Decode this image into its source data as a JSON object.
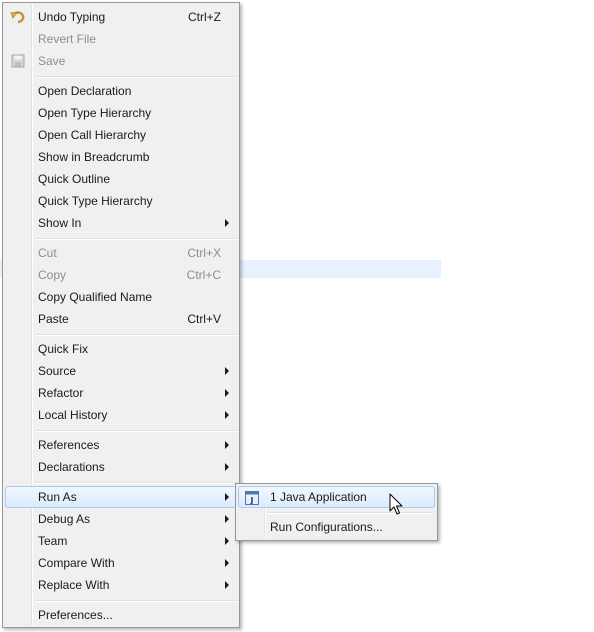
{
  "context_menu": {
    "items": [
      {
        "label": "Undo Typing",
        "shortcut": "Ctrl+Z",
        "icon": "undo-icon"
      },
      {
        "label": "Revert File"
      },
      {
        "label": "Save",
        "icon": "save-icon"
      },
      {
        "label": "Open Declaration"
      },
      {
        "label": "Open Type Hierarchy"
      },
      {
        "label": "Open Call Hierarchy"
      },
      {
        "label": "Show in Breadcrumb"
      },
      {
        "label": "Quick Outline"
      },
      {
        "label": "Quick Type Hierarchy"
      },
      {
        "label": "Show In"
      },
      {
        "label": "Cut",
        "shortcut": "Ctrl+X"
      },
      {
        "label": "Copy",
        "shortcut": "Ctrl+C"
      },
      {
        "label": "Copy Qualified Name"
      },
      {
        "label": "Paste",
        "shortcut": "Ctrl+V"
      },
      {
        "label": "Quick Fix"
      },
      {
        "label": "Source"
      },
      {
        "label": "Refactor"
      },
      {
        "label": "Local History"
      },
      {
        "label": "References"
      },
      {
        "label": "Declarations"
      },
      {
        "label": "Run As"
      },
      {
        "label": "Debug As"
      },
      {
        "label": "Team"
      },
      {
        "label": "Compare With"
      },
      {
        "label": "Replace With"
      },
      {
        "label": "Preferences..."
      }
    ]
  },
  "run_as_submenu": {
    "items": [
      {
        "label": "1 Java Application",
        "icon": "java-application-icon"
      },
      {
        "label": "Run Configurations..."
      }
    ]
  },
  "colors": {
    "menu_background": "#f0f0f0",
    "highlight_border": "#a9c9f2",
    "disabled_text": "#8d8d8d",
    "editor_line_highlight": "#e8f2fe"
  }
}
